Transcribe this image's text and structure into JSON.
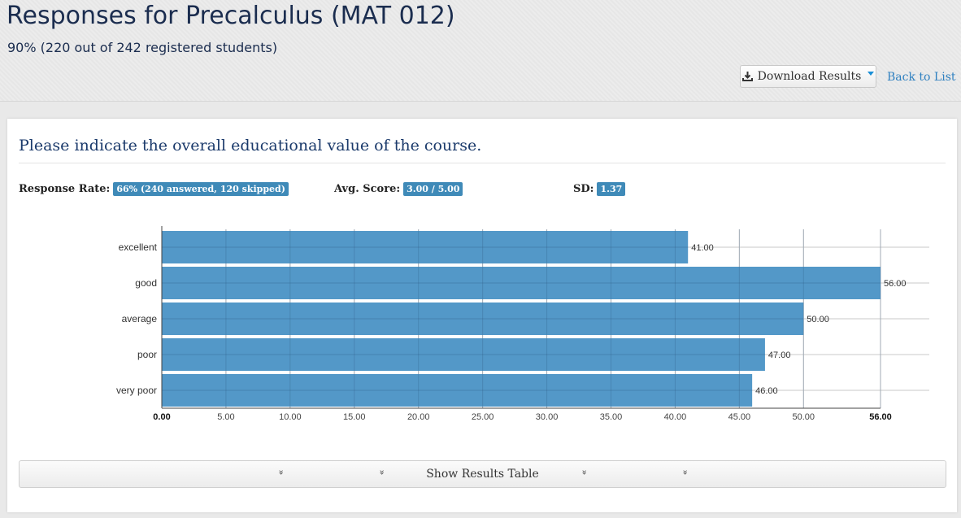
{
  "header": {
    "title": "Responses for Precalculus (MAT 012)",
    "subtitle": "90% (220 out of 242 registered students)",
    "download_label": "Download Results",
    "back_label": "Back to List"
  },
  "question": {
    "text": "Please indicate the overall educational value of the course.",
    "response_rate_label": "Response Rate:",
    "response_rate_value": "66% (240 answered, 120 skipped)",
    "avg_label": "Avg. Score:",
    "avg_value": "3.00 / 5.00",
    "sd_label": "SD:",
    "sd_value": "1.37"
  },
  "chart_data": {
    "type": "bar",
    "orientation": "horizontal",
    "categories": [
      "excellent",
      "good",
      "average",
      "poor",
      "very poor"
    ],
    "values": [
      41,
      56,
      50,
      47,
      46
    ],
    "value_labels": [
      "41.00",
      "56.00",
      "50.00",
      "47.00",
      "46.00"
    ],
    "xlim": [
      0,
      56
    ],
    "x_ticks": [
      "0.00",
      "5.00",
      "10.00",
      "15.00",
      "20.00",
      "25.00",
      "30.00",
      "35.00",
      "40.00",
      "45.00",
      "50.00",
      "56.00"
    ],
    "x_tick_values": [
      0,
      5,
      10,
      15,
      20,
      25,
      30,
      35,
      40,
      45,
      50,
      56
    ],
    "grid": true,
    "bar_color": "#5398c8"
  },
  "results_table": {
    "toggle_label": "Show Results Table",
    "chevron": "»"
  },
  "colors": {
    "title": "#1b2d4f",
    "badge": "#3f8ab8",
    "link": "#2f80c0"
  }
}
